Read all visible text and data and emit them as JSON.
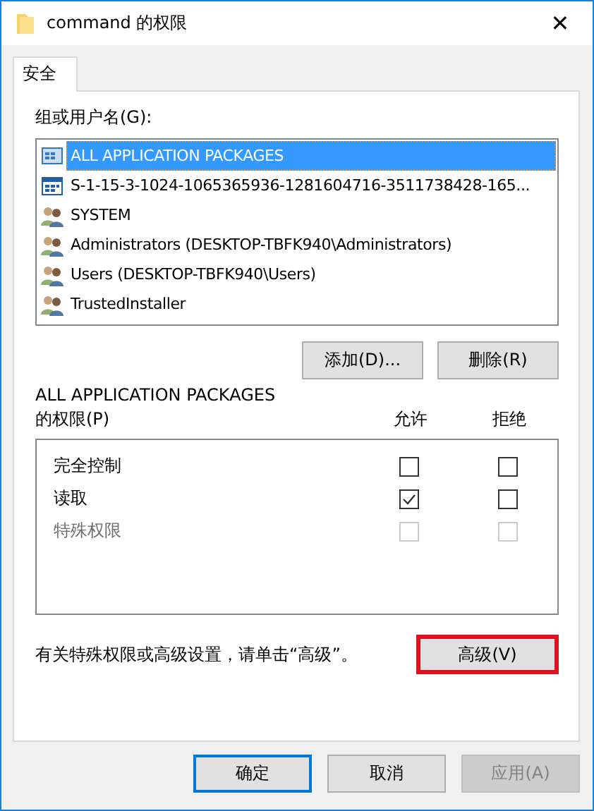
{
  "window": {
    "title": "command 的权限",
    "close": "✕"
  },
  "tabs": [
    {
      "label": "安全",
      "selected": true
    }
  ],
  "principals": {
    "label": "组或用户名(G):",
    "items": [
      {
        "name": "ALL APPLICATION PACKAGES",
        "kind": "package",
        "selected": true
      },
      {
        "name": "S-1-15-3-1024-1065365936-1281604716-3511738428-165...",
        "kind": "sid",
        "selected": false
      },
      {
        "name": "SYSTEM",
        "kind": "group",
        "selected": false
      },
      {
        "name": "Administrators (DESKTOP-TBFK940\\Administrators)",
        "kind": "group",
        "selected": false
      },
      {
        "name": "Users (DESKTOP-TBFK940\\Users)",
        "kind": "group",
        "selected": false
      },
      {
        "name": "TrustedInstaller",
        "kind": "group",
        "selected": false
      }
    ]
  },
  "principal_buttons": [
    "添加(D)...",
    "删除(R)"
  ],
  "permissions": {
    "title": "ALL APPLICATION PACKAGES",
    "label": "的权限(P)",
    "allow_header": "允许",
    "deny_header": "拒绝",
    "rows": [
      {
        "name": "完全控制",
        "allow": false,
        "deny": false,
        "disabled": false
      },
      {
        "name": "读取",
        "allow": true,
        "deny": false,
        "disabled": false
      },
      {
        "name": "特殊权限",
        "allow": false,
        "deny": false,
        "disabled": true
      }
    ]
  },
  "advanced": {
    "text": "有关特殊权限或高级设置，请单击“高级”。",
    "button": "高级(V)",
    "highlighted": true
  },
  "footer_buttons": [
    {
      "label": "确定",
      "default": true,
      "disabled": false
    },
    {
      "label": "取消",
      "default": false,
      "disabled": false
    },
    {
      "label": "应用(A)",
      "default": false,
      "disabled": true
    }
  ]
}
